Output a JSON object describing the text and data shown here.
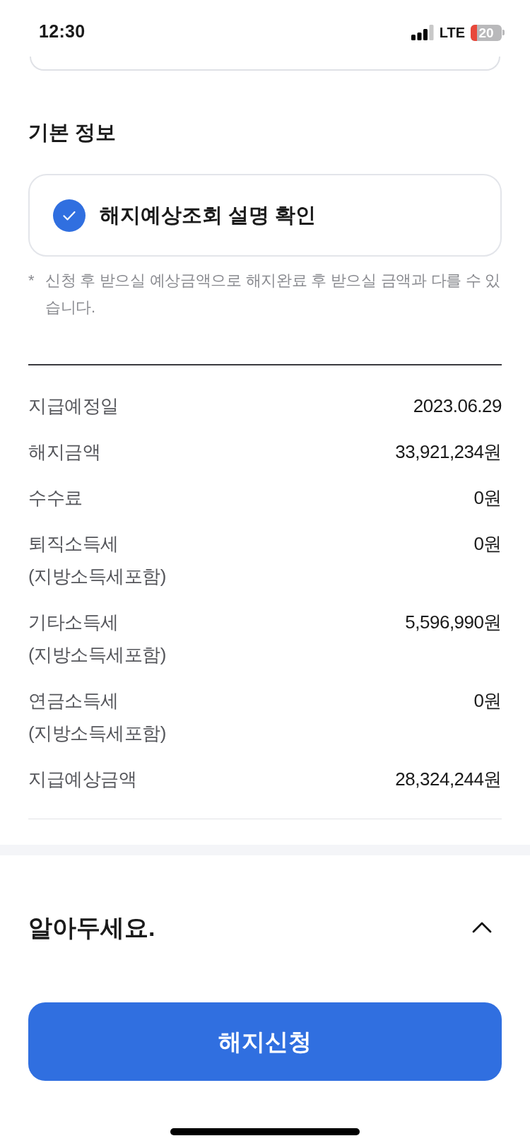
{
  "status_bar": {
    "time": "12:30",
    "network": "LTE",
    "battery": "20"
  },
  "section_title": "기본 정보",
  "confirm": {
    "label": "해지예상조회 설명 확인",
    "checked": true
  },
  "note": {
    "mark": "*",
    "text": "신청 후 받으실 예상금액으로 해지완료 후 받으실 금액과 다를 수 있습니다."
  },
  "details": [
    {
      "label": "지급예정일",
      "value": "2023.06.29"
    },
    {
      "label": "해지금액",
      "value": "33,921,234원"
    },
    {
      "label": "수수료",
      "value": "0원"
    },
    {
      "label": "퇴직소득세",
      "sublabel": "(지방소득세포함)",
      "value": "0원"
    },
    {
      "label": "기타소득세",
      "sublabel": "(지방소득세포함)",
      "value": "5,596,990원"
    },
    {
      "label": "연금소득세",
      "sublabel": "(지방소득세포함)",
      "value": "0원"
    },
    {
      "label": "지급예상금액",
      "value": "28,324,244원"
    }
  ],
  "notice": {
    "title": "알아두세요.",
    "expanded": true
  },
  "primary_button": {
    "label": "해지신청"
  }
}
